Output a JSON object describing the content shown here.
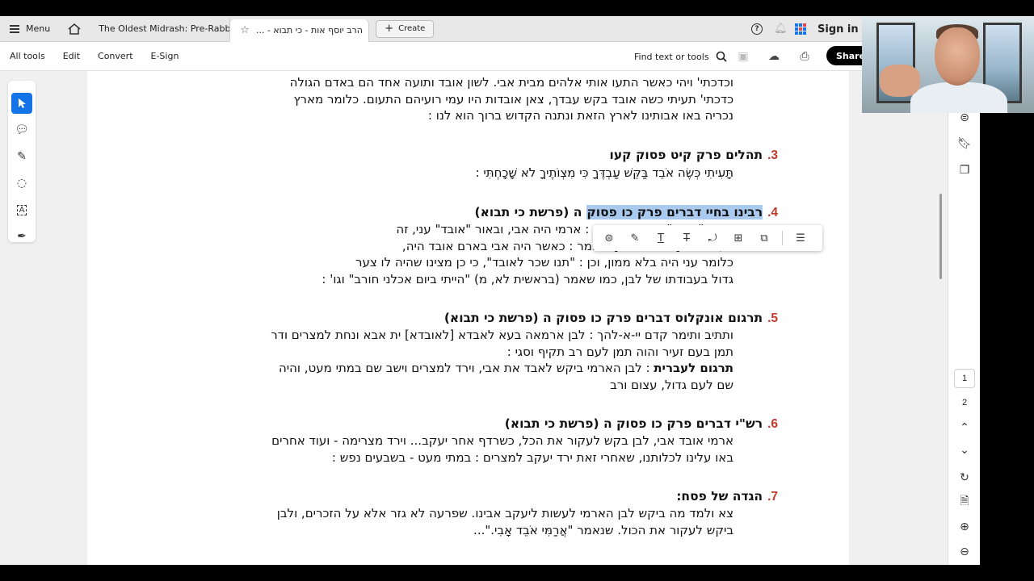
{
  "tabbar": {
    "menu_label": "Menu",
    "tab1_title": "The Oldest Midrash: Pre-Rabbini...",
    "tab2_title": "הרב יוסף אות - כי תבוא - ...",
    "create_label": "Create",
    "signin_label": "Sign in"
  },
  "toolbar": {
    "all_tools": "All tools",
    "edit": "Edit",
    "convert": "Convert",
    "esign": "E-Sign",
    "find_label": "Find text or tools",
    "share_label": "Share"
  },
  "document": {
    "top_lines": [
      "וכדכתי' ויהי כאשר התעו אותי אלהים מבית אבי. לשון אובד ותועה אחד הם באדם הגולה",
      "כדכתי' תעיתי כשה אובד בקש עבדך, צאן אובדות היו עמי רועיהם התעום. כלומר מארץ",
      "נכריה באו אבותינו לארץ הזאת ונתנה הקדוש ברוך הוא לנו :"
    ],
    "sections": [
      {
        "num": ".3",
        "title": "תהלים פרק קיט פסוק קעו",
        "lines": [
          "תָּעִיתִי כְּשֶׂה אֹבֵד בַּקֵּשׁ עַבְדֶּךָ כִּי מִצְוֹתֶיךָ לֹא שָׁכָחְתִּי :"
        ]
      },
      {
        "num": ".4",
        "title_highlight": "רבינו בחיי דברים פרק כו פסוק",
        "title_rest": "ה (פרשת כי תבוא)",
        "lines": [
          "יעקב \"ארמי\", ושעור הכתוב : ארמי היה אבי, ובאור \"אובד\" עני, זה",
          "דעת רז\"ל [כפי שנראה]. ויאמר : כאשר היה אבי בארם אובד היה,",
          "כלומר עני היה בלא ממון, וכן : \"תנו שכר לאובד\", כי כן מצינו שהיה לו צער",
          "גדול בעבודתו של לבן, כמו שאמר (בראשית לא, מ) \"הייתי ביום אכלני חורב\" וגו' :"
        ]
      },
      {
        "num": ".5",
        "title": "תרגום אונקלוס דברים פרק כו פסוק ה (פרשת כי תבוא)",
        "lines": [
          "ותתיב ותימר קדם יי-א-להך : לבן ארמאה בעא לאבדא [לאובדא] ית אבא ונחת למצרים ודר",
          "תמן בעם זעיר והוה תמן לעם רב תקיף וסגי :"
        ],
        "trans_label": "תרגום לעברית",
        "trans_lines": [
          ": לבן הארמי ביקש לאבד את אבי, וירד למצרים וישב שם במתי מעט, והיה",
          "שם לעם גדול, עצום ורב"
        ]
      },
      {
        "num": ".6",
        "title": "רש\"י דברים פרק כו פסוק ה (פרשת כי תבוא)",
        "lines": [
          "ארמי אובד אבי, לבן בקש לעקור את הכל, כשרדף אחר יעקב... וירד מצרימה - ועוד אחרים",
          "באו עלינו לכלותנו, שאחרי זאת ירד יעקב למצרים : במתי מעט - בשבעים נפש :"
        ]
      },
      {
        "num": ".7",
        "title": "הגדה של פסח:",
        "lines": [
          "צא ולמד מה ביקש לבן הארמי לעשות ליעקב אבינו. שפרעה לא גזר אלא על הזכרים, ולבן",
          "ביקש לעקור את הכול. שנאמר \"אֲרַמִּי אֹבֵד אָבִי.\"..."
        ]
      }
    ]
  },
  "pages": {
    "page1": "1",
    "page2": "2"
  },
  "colors": {
    "accent": "#1473e6",
    "section_number": "#c0392b",
    "highlight": "#a9c9ef"
  }
}
